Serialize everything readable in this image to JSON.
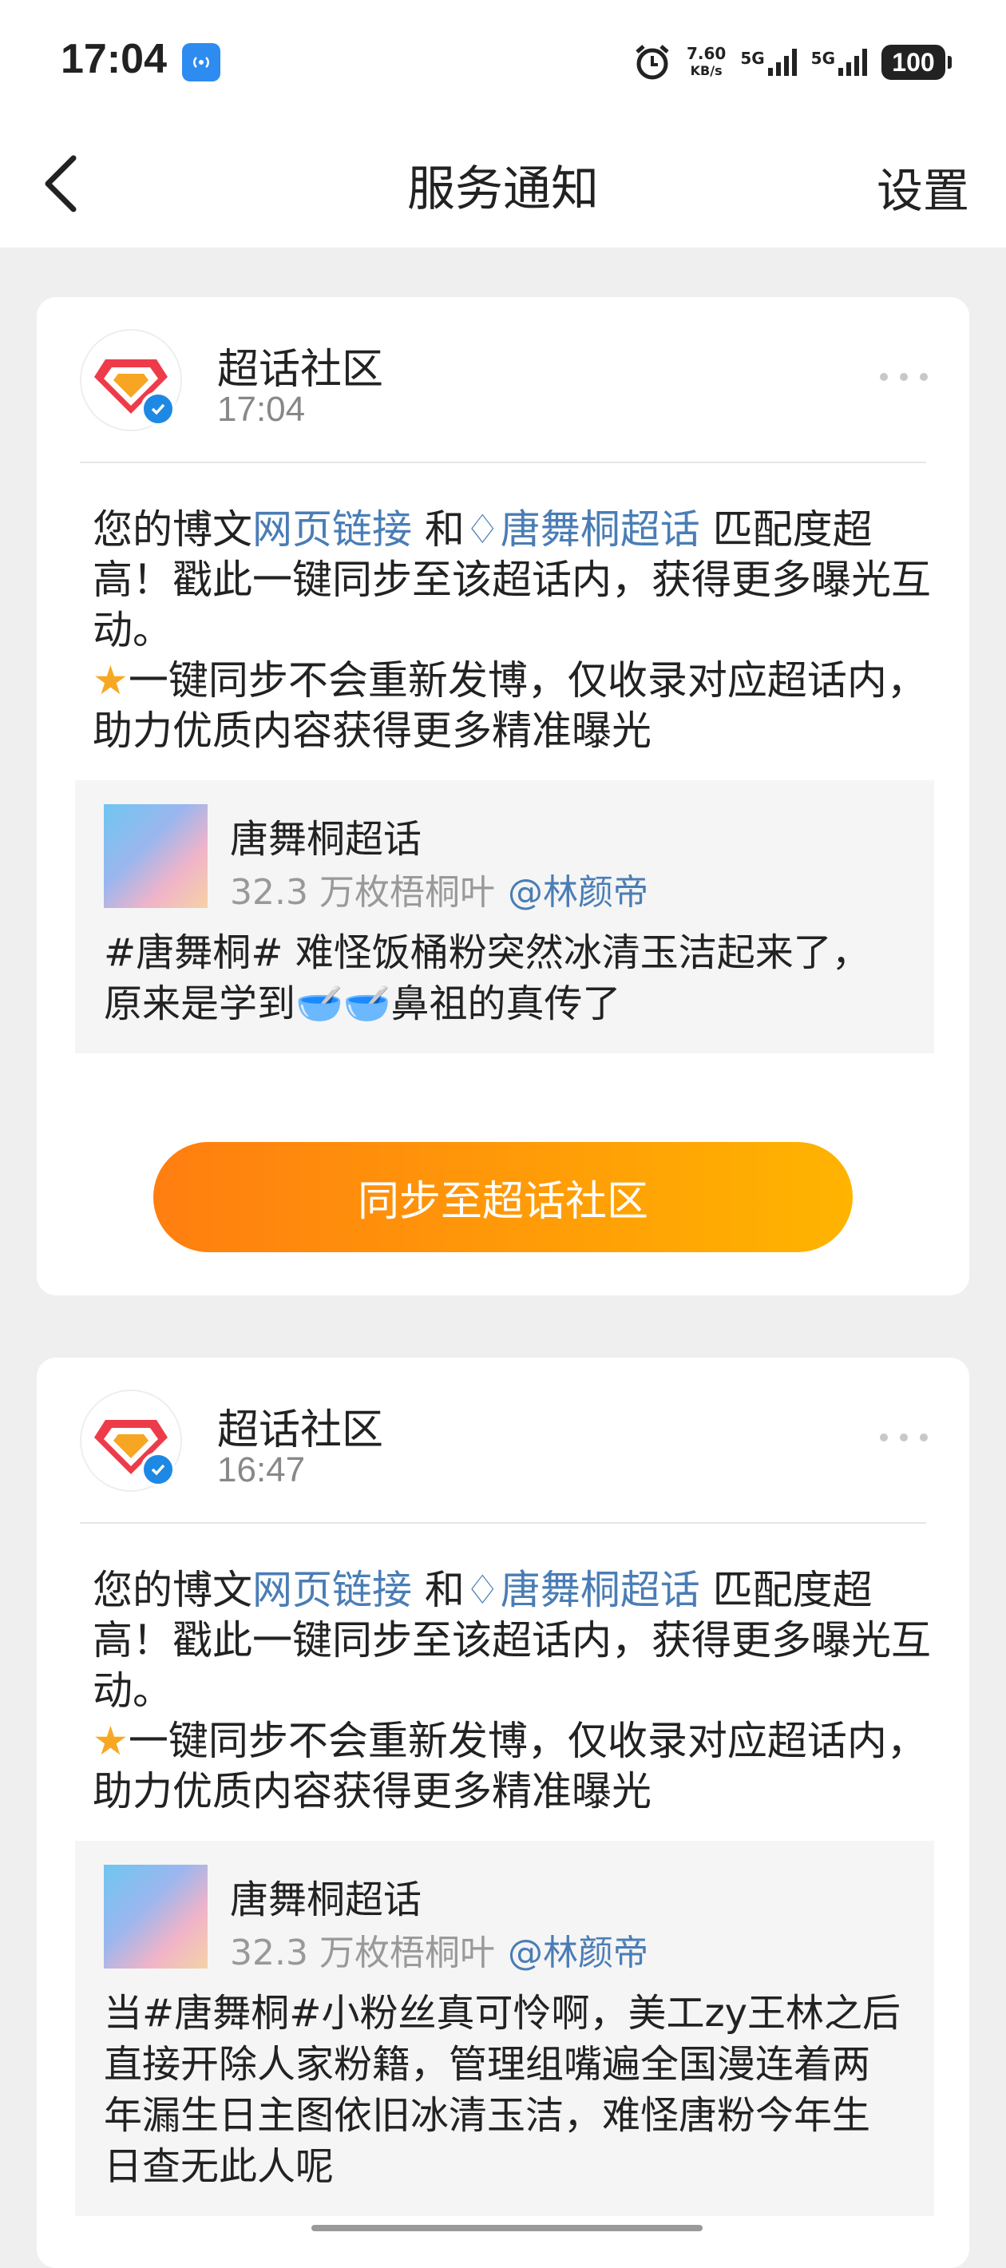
{
  "status_bar": {
    "time": "17:04",
    "speed_value": "7.60",
    "speed_unit": "KB/s",
    "net1": "5G",
    "net2": "5G",
    "battery": "100"
  },
  "nav": {
    "title": "服务通知",
    "settings": "设置"
  },
  "notifications": [
    {
      "sender": "超话社区",
      "time": "17:04",
      "msg_prefix": "您的博文",
      "msg_link1": "网页链接",
      "msg_mid": " 和",
      "msg_link2": "唐舞桐超话",
      "msg_suffix": " 匹配度超高！戳此一键同步至该超话内，获得更多曝光互动。",
      "msg_note": "一键同步不会重新发博，仅收录对应超话内，助力优质内容获得更多精准曝光",
      "quote_name": "唐舞桐超话",
      "quote_meta": "32.3 万枚梧桐叶",
      "quote_at": "@林颜帝",
      "quote_text": "#唐舞桐# 难怪饭桶粉突然冰清玉洁起来了，原来是学到🥣🥣鼻祖的真传了",
      "action": "同步至超话社区"
    },
    {
      "sender": "超话社区",
      "time": "16:47",
      "msg_prefix": "您的博文",
      "msg_link1": "网页链接",
      "msg_mid": " 和",
      "msg_link2": "唐舞桐超话",
      "msg_suffix": " 匹配度超高！戳此一键同步至该超话内，获得更多曝光互动。",
      "msg_note": "一键同步不会重新发博，仅收录对应超话内，助力优质内容获得更多精准曝光",
      "quote_name": "唐舞桐超话",
      "quote_meta": "32.3 万枚梧桐叶",
      "quote_at": "@林颜帝",
      "quote_text": "当#唐舞桐#小粉丝真可怜啊，美工zy王林之后直接开除人家粉籍，管理组嘴遍全国漫连着两年漏生日主图依旧冰清玉洁，难怪唐粉今年生日查无此人呢"
    }
  ],
  "colors": {
    "accent_link": "#4a7db5",
    "button_start": "#ff7e10",
    "button_end": "#ffb400",
    "verified": "#1e88e5"
  }
}
